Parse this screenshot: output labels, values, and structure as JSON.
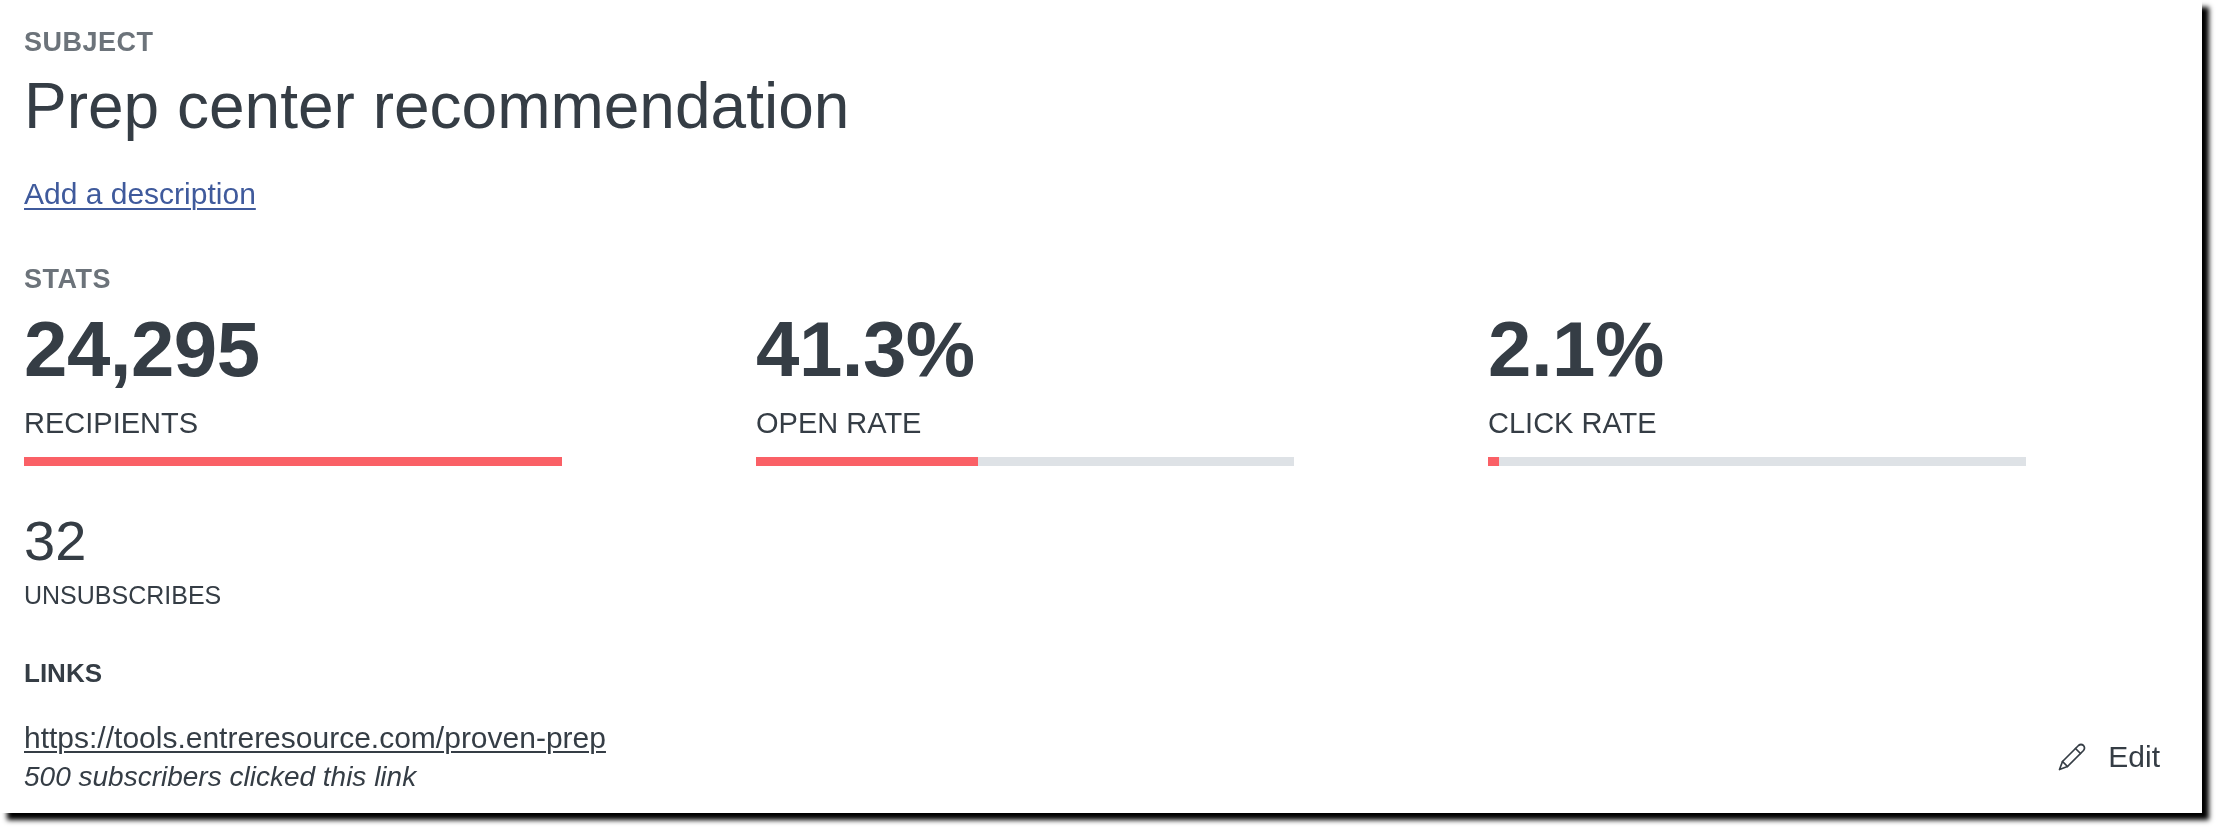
{
  "subject": {
    "label": "SUBJECT",
    "title": "Prep center recommendation",
    "description_link": "Add a description"
  },
  "stats": {
    "label": "STATS",
    "metrics": [
      {
        "value": "24,295",
        "label": "RECIPIENTS",
        "level": 1
      },
      {
        "value": "41.3%",
        "label": "OPEN RATE",
        "level": 0.413
      },
      {
        "value": "2.1%",
        "label": "CLICK RATE",
        "level": 0.021
      }
    ],
    "unsubscribes": {
      "value": "32",
      "label": "UNSUBSCRIBES"
    }
  },
  "links": {
    "label": "LINKS",
    "items": [
      {
        "url": "https://tools.entreresource.com/proven-prep",
        "clicks": "500 subscribers clicked this link"
      }
    ]
  },
  "edit_button": {
    "label": "Edit"
  }
}
